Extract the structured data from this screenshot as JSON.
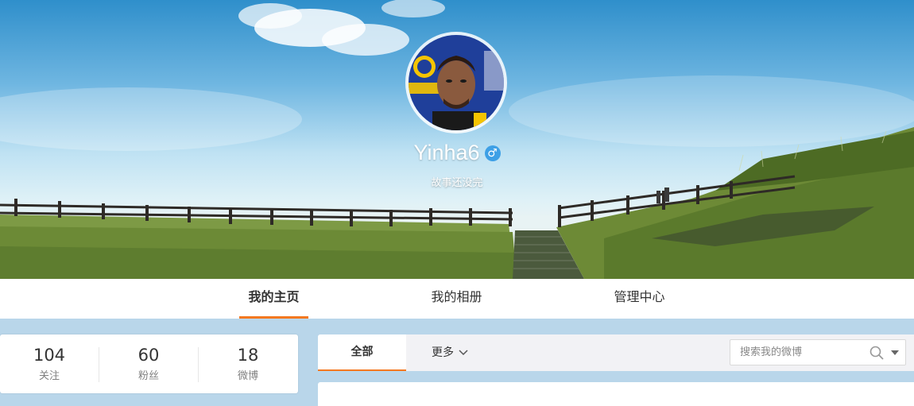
{
  "profile": {
    "username": "Yinha6",
    "gender_symbol": "♂",
    "bio": "故事还没完"
  },
  "tabs": [
    {
      "label": "我的主页",
      "active": true
    },
    {
      "label": "我的相册",
      "active": false
    },
    {
      "label": "管理中心",
      "active": false
    }
  ],
  "stats": [
    {
      "value": "104",
      "label": "关注"
    },
    {
      "value": "60",
      "label": "粉丝"
    },
    {
      "value": "18",
      "label": "微博"
    }
  ],
  "feed": {
    "tab_all": "全部",
    "tab_more": "更多"
  },
  "search": {
    "placeholder": "搜索我的微博"
  },
  "colors": {
    "accent": "#f47920",
    "gender_badge": "#3ea0e6"
  },
  "icons": [
    "gender-male-icon",
    "chevron-down-icon",
    "search-icon",
    "caret-down-icon"
  ]
}
